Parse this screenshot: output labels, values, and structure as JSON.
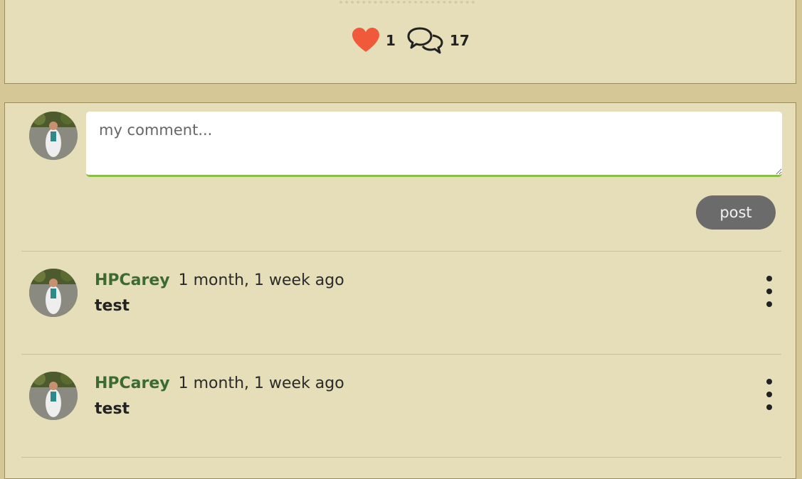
{
  "stats": {
    "likes": "1",
    "comments": "17",
    "like_icon": "heart-icon",
    "comment_icon": "speech-bubbles-icon",
    "like_color": "#f05a3a"
  },
  "compose": {
    "placeholder": "my comment...",
    "post_label": "post",
    "accent_color": "#8bbd4a"
  },
  "comments": [
    {
      "author": "HPCarey",
      "time": "1 month, 1 week ago",
      "text": "test"
    },
    {
      "author": "HPCarey",
      "time": "1 month, 1 week ago",
      "text": "test"
    }
  ]
}
